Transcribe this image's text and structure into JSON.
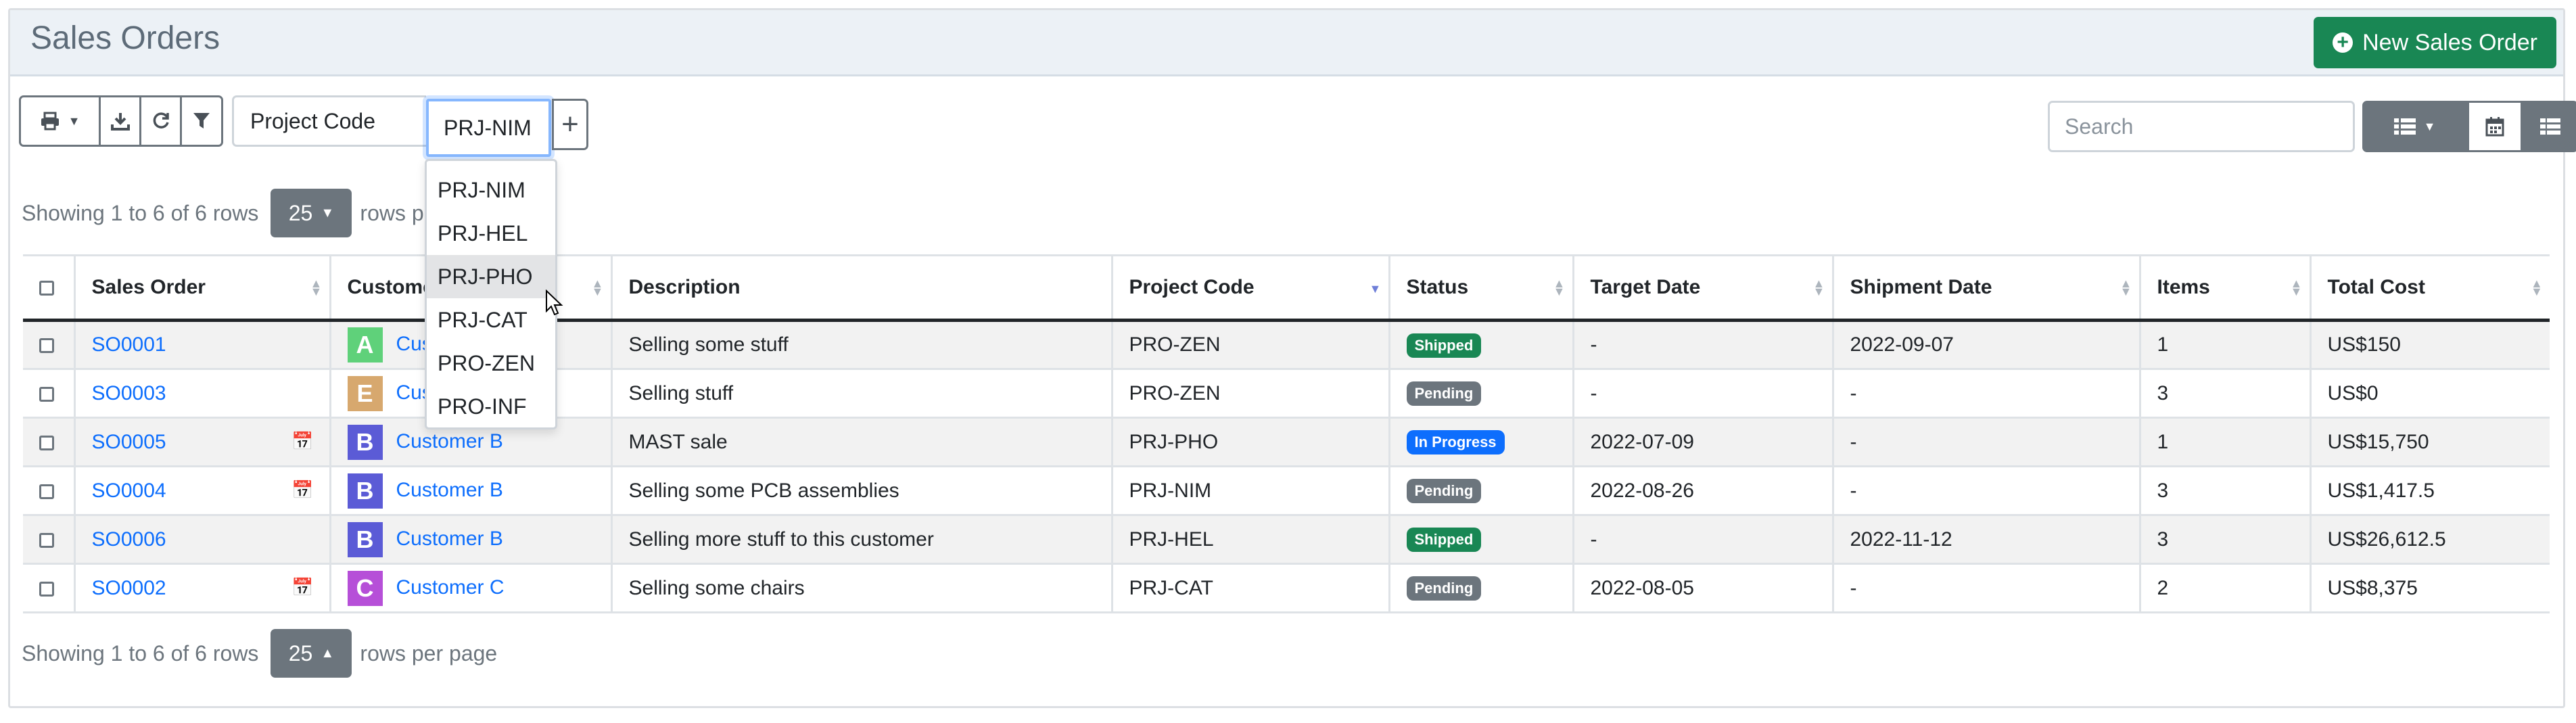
{
  "header": {
    "title": "Sales Orders",
    "new_button_label": "New Sales Order"
  },
  "colors": {
    "accent": "#198754",
    "link": "#0d6efd",
    "secondary": "#6c757d",
    "shipped": "#198754",
    "pending": "#6c757d",
    "in_progress": "#0d6efd"
  },
  "toolbar": {
    "print_icon": "print-icon",
    "download_icon": "download-icon",
    "refresh_icon": "refresh-icon",
    "filter_icon": "filter-icon"
  },
  "filter": {
    "label": "Project Code",
    "selected": "PRJ-NIM",
    "add_icon": "plus-icon",
    "options": [
      "PRJ-NIM",
      "PRJ-HEL",
      "PRJ-PHO",
      "PRJ-CAT",
      "PRO-ZEN",
      "PRO-INF"
    ],
    "hovered_option": "PRJ-PHO"
  },
  "search": {
    "placeholder": "Search"
  },
  "pagination": {
    "showing_text": "Showing 1 to 6 of 6 rows",
    "page_size": "25",
    "rows_per_page": "rows per page"
  },
  "table": {
    "columns": [
      "Sales Order",
      "Customer",
      "Description",
      "Project Code",
      "Status",
      "Target Date",
      "Shipment Date",
      "Items",
      "Total Cost"
    ],
    "rows": [
      {
        "order": "SO0001",
        "overdue": false,
        "avatar": "A",
        "avatar_color": "#5fd17a",
        "customer": "Customer A",
        "description": "Selling some stuff",
        "project": "PRO-ZEN",
        "status": "Shipped",
        "status_color": "#198754",
        "target": "-",
        "shipment": "2022-09-07",
        "items": "1",
        "cost": "US$150"
      },
      {
        "order": "SO0003",
        "overdue": false,
        "avatar": "E",
        "avatar_color": "#d7a86e",
        "customer": "Customer E",
        "description": "Selling stuff",
        "project": "PRO-ZEN",
        "status": "Pending",
        "status_color": "#6c757d",
        "target": "-",
        "shipment": "-",
        "items": "3",
        "cost": "US$0"
      },
      {
        "order": "SO0005",
        "overdue": true,
        "avatar": "B",
        "avatar_color": "#5b5bd6",
        "customer": "Customer B",
        "description": "MAST sale",
        "project": "PRJ-PHO",
        "status": "In Progress",
        "status_color": "#0d6efd",
        "target": "2022-07-09",
        "shipment": "-",
        "items": "1",
        "cost": "US$15,750"
      },
      {
        "order": "SO0004",
        "overdue": true,
        "avatar": "B",
        "avatar_color": "#5b5bd6",
        "customer": "Customer B",
        "description": "Selling some PCB assemblies",
        "project": "PRJ-NIM",
        "status": "Pending",
        "status_color": "#6c757d",
        "target": "2022-08-26",
        "shipment": "-",
        "items": "3",
        "cost": "US$1,417.5"
      },
      {
        "order": "SO0006",
        "overdue": false,
        "avatar": "B",
        "avatar_color": "#5b5bd6",
        "customer": "Customer B",
        "description": "Selling more stuff to this customer",
        "project": "PRJ-HEL",
        "status": "Shipped",
        "status_color": "#198754",
        "target": "-",
        "shipment": "2022-11-12",
        "items": "3",
        "cost": "US$26,612.5"
      },
      {
        "order": "SO0002",
        "overdue": true,
        "avatar": "C",
        "avatar_color": "#b64fd8",
        "customer": "Customer C",
        "description": "Selling some chairs",
        "project": "PRJ-CAT",
        "status": "Pending",
        "status_color": "#6c757d",
        "target": "2022-08-05",
        "shipment": "-",
        "items": "2",
        "cost": "US$8,375"
      }
    ]
  }
}
